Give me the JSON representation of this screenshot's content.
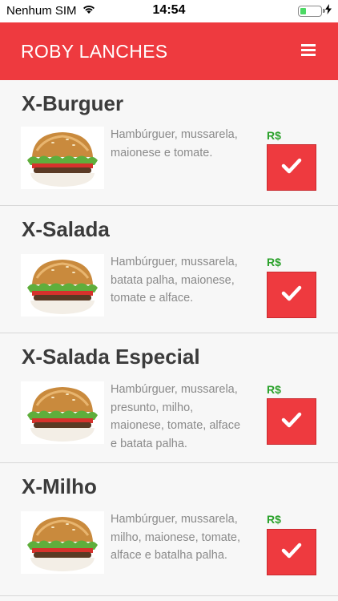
{
  "status": {
    "carrier": "Nenhum SIM",
    "time": "14:54"
  },
  "header": {
    "title": "ROBY LANCHES",
    "menu_icon": "hamburger-menu-icon"
  },
  "colors": {
    "brand_red": "#ee3a3f",
    "price_green": "#2aa12a"
  },
  "menu": {
    "items": [
      {
        "name": "X-Burguer",
        "description_lines": [
          "Hambúrguer, mussarela,",
          "maionese e tomate."
        ],
        "price_label": "R$"
      },
      {
        "name": "X-Salada",
        "description_lines": [
          "Hambúrguer, mussarela,",
          "batata palha, maionese,",
          "tomate e alface."
        ],
        "price_label": "R$"
      },
      {
        "name": "X-Salada Especial",
        "description_lines": [
          "Hambúrguer, mussarela,",
          "presunto, milho,",
          "maionese, tomate, alface",
          "e batata palha."
        ],
        "price_label": "R$"
      },
      {
        "name": "X-Milho",
        "description_lines": [
          "Hambúrguer, mussarela,",
          "milho, maionese, tomate,",
          "alface e batalha palha."
        ],
        "price_label": "R$"
      }
    ]
  }
}
